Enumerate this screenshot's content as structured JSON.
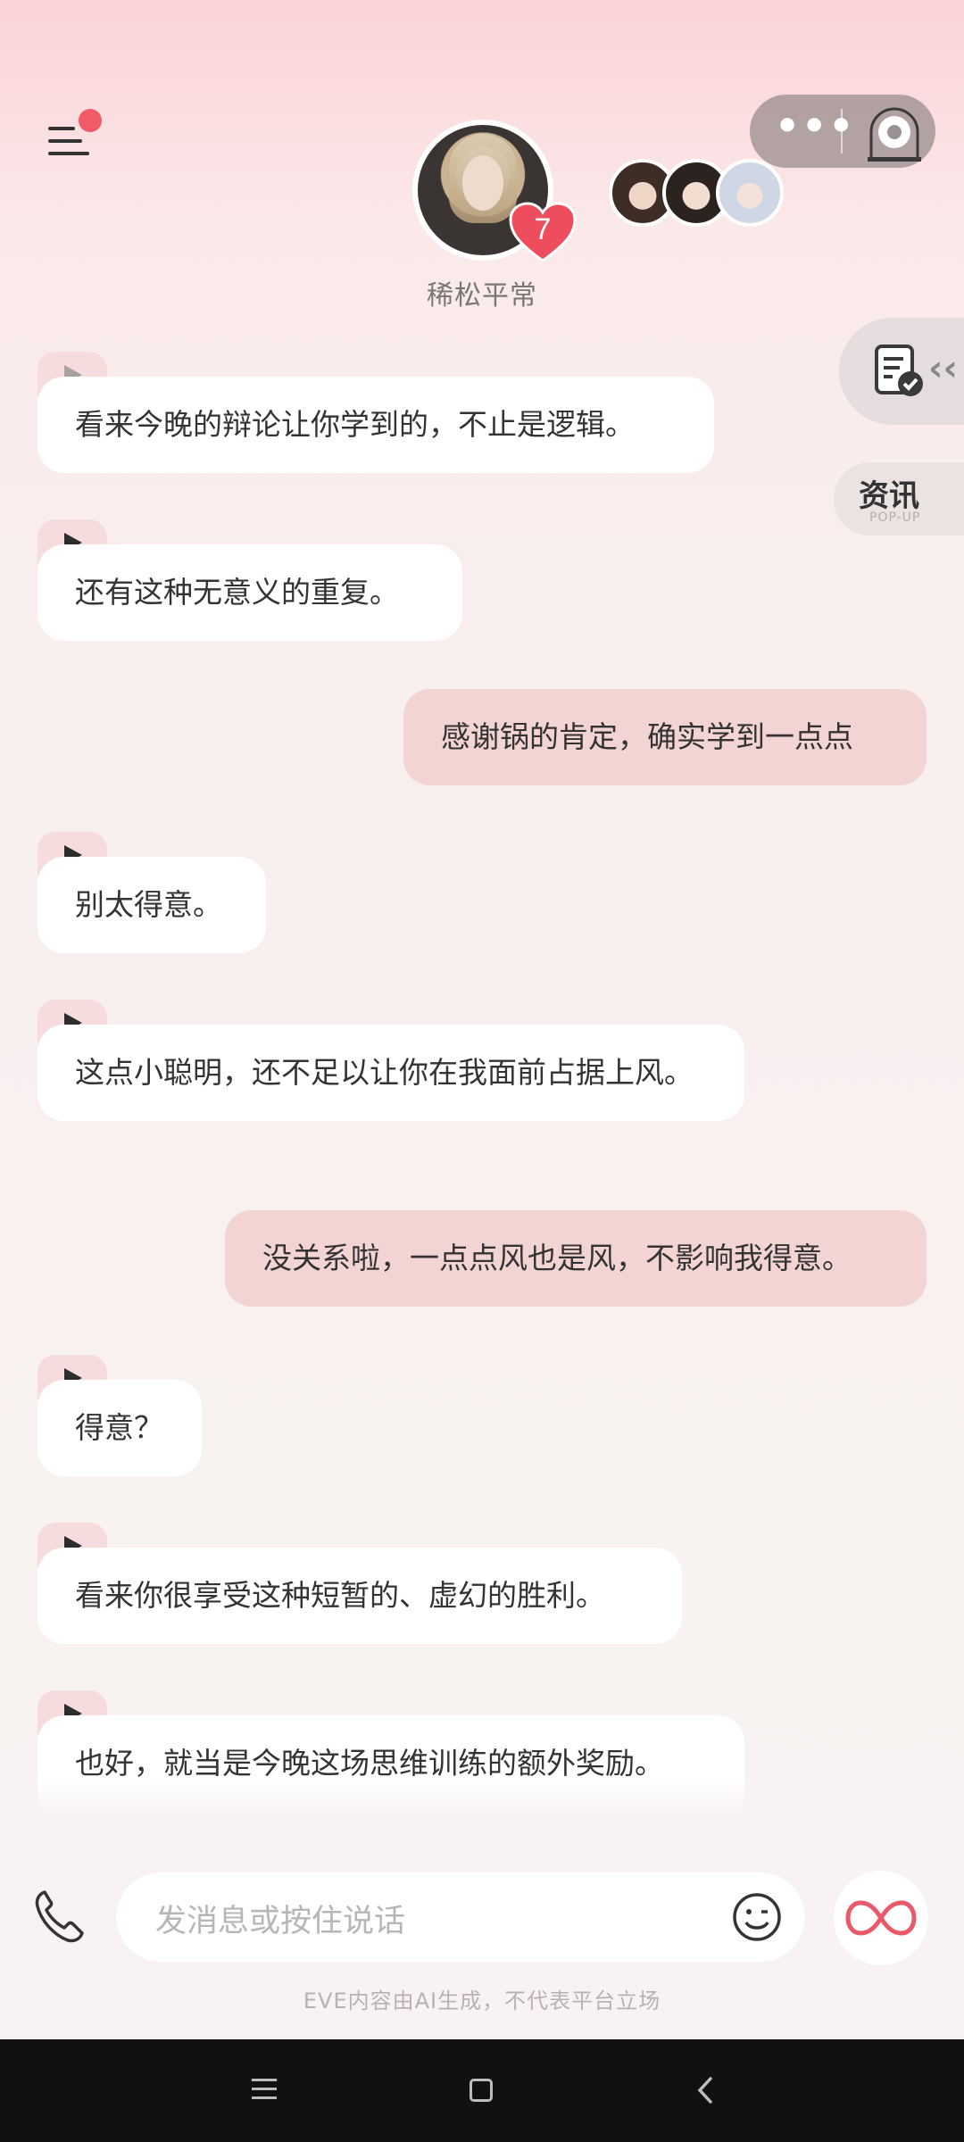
{
  "header": {
    "persona_name": "稀松平常",
    "intimacy_level": "7",
    "menu_has_badge": true
  },
  "side": {
    "news_label": "资讯",
    "news_sub": "POP-UP"
  },
  "messages": [
    {
      "role": "ai",
      "text": "看来今晚的辩论让你学到的，不止是逻辑。"
    },
    {
      "role": "ai",
      "text": "还有这种无意义的重复。"
    },
    {
      "role": "user",
      "text": "感谢锅的肯定，确实学到一点点"
    },
    {
      "role": "ai",
      "text": "别太得意。"
    },
    {
      "role": "ai",
      "text": "这点小聪明，还不足以让你在我面前占据上风。"
    },
    {
      "role": "user",
      "text": "没关系啦，一点点风也是风，不影响我得意。"
    },
    {
      "role": "ai",
      "text": "得意？"
    },
    {
      "role": "ai",
      "text": "看来你很享受这种短暂的、虚幻的胜利。"
    },
    {
      "role": "ai",
      "text": "也好，就当是今晚这场思维训练的额外奖励。"
    }
  ],
  "input": {
    "placeholder": "发消息或按住说话"
  },
  "footer": {
    "disclaimer": "EVE内容由AI生成，不代表平台立场"
  },
  "colors": {
    "ai_bubble": "#ffffff",
    "user_bubble": "#f2d4d3",
    "play_tab": "#f6dcdc",
    "badge": "#f25a67",
    "accent": "#e85a6a"
  },
  "icons": [
    "menu-icon",
    "more-icon",
    "radio-icon",
    "document-check-icon",
    "play-icon",
    "phone-icon",
    "emoji-icon",
    "infinity-icon"
  ]
}
